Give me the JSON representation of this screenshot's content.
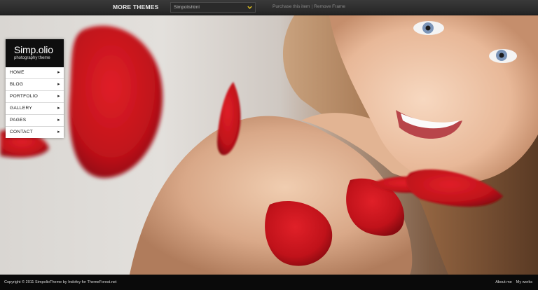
{
  "topbar": {
    "more_themes": "MORE THEMES",
    "selected_theme": "Simpolishtml",
    "purchase_link": "Purchase this item",
    "separator": "|",
    "remove_frame_link": "Remove Frame"
  },
  "logo": {
    "title": "Simp.olio",
    "subtitle": "photography theme"
  },
  "menu": {
    "items": [
      {
        "label": "HOME"
      },
      {
        "label": "BLOG"
      },
      {
        "label": "PORTFOLIO"
      },
      {
        "label": "GALLERY"
      },
      {
        "label": "PAGES"
      },
      {
        "label": "CONTACT"
      }
    ]
  },
  "footer": {
    "copyright": "Copyright © 2011 SimpolioTheme by Indofey for ThemeForest.net",
    "about": "About me",
    "works": "My works"
  },
  "colors": {
    "petal": "#c8141c",
    "topbar": "#2e2e2e",
    "footer": "#0a0a0a",
    "accent_chevron": "#e0c020"
  }
}
